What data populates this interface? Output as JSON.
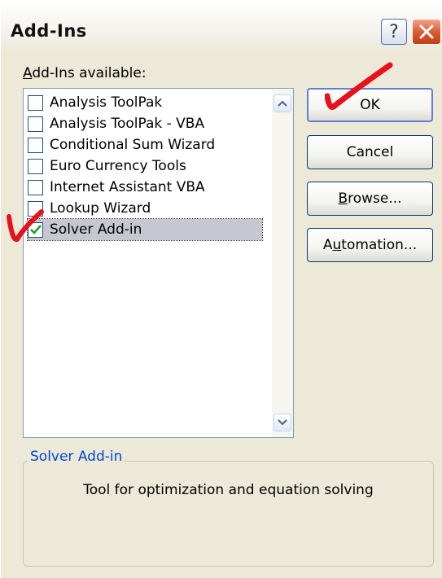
{
  "dialog": {
    "title": "Add-Ins",
    "help_glyph": "?",
    "close_icon": "close-icon"
  },
  "list": {
    "label_accel": "A",
    "label_rest": "dd-Ins available:",
    "items": [
      {
        "label": "Analysis ToolPak",
        "checked": false,
        "selected": false
      },
      {
        "label": "Analysis ToolPak - VBA",
        "checked": false,
        "selected": false
      },
      {
        "label": "Conditional Sum Wizard",
        "checked": false,
        "selected": false
      },
      {
        "label": "Euro Currency Tools",
        "checked": false,
        "selected": false
      },
      {
        "label": "Internet Assistant VBA",
        "checked": false,
        "selected": false
      },
      {
        "label": "Lookup Wizard",
        "checked": false,
        "selected": false
      },
      {
        "label": "Solver Add-in",
        "checked": true,
        "selected": true
      }
    ]
  },
  "buttons": {
    "ok": "OK",
    "cancel": "Cancel",
    "browse_accel": "B",
    "browse_rest": "rowse...",
    "automation_pre": "A",
    "automation_accel": "u",
    "automation_rest": "tomation..."
  },
  "description": {
    "legend": "Solver Add-in",
    "text": "Tool for optimization and equation solving"
  },
  "colors": {
    "annotation_red": "#e8101a",
    "check_green": "#21a121",
    "legend_blue": "#0046d5"
  }
}
